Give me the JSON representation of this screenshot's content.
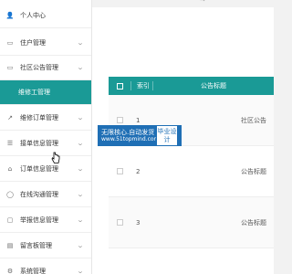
{
  "breadcrumb": "→",
  "sidebar": {
    "items": [
      {
        "label": "个人中心",
        "icon": "user-icon",
        "glyph": "👤",
        "active": false
      },
      {
        "label": "住户管理",
        "icon": "list-icon",
        "glyph": "▭",
        "active": false
      },
      {
        "label": "社区公告管理",
        "icon": "list-icon",
        "glyph": "▭",
        "active": false
      },
      {
        "label": "维修工管理",
        "icon": "",
        "glyph": "",
        "active": true
      },
      {
        "label": "维修订单管理",
        "icon": "chart-icon",
        "glyph": "↗",
        "active": false
      },
      {
        "label": "接单信息管理",
        "icon": "menu-icon",
        "glyph": "☰",
        "active": false
      },
      {
        "label": "订单信息管理",
        "icon": "cart-icon",
        "glyph": "⌂",
        "active": false
      },
      {
        "label": "在线沟通管理",
        "icon": "chat-icon",
        "glyph": "◯",
        "active": false
      },
      {
        "label": "举报信息管理",
        "icon": "copy-icon",
        "glyph": "▢",
        "active": false
      },
      {
        "label": "留言板管理",
        "icon": "message-icon",
        "glyph": "▤",
        "active": false
      },
      {
        "label": "系统管理",
        "icon": "gear-icon",
        "glyph": "⚙",
        "active": false
      }
    ]
  },
  "table": {
    "headers": {
      "index": "索引",
      "title": "公告标题"
    },
    "rows": [
      {
        "index": "1",
        "title": "社区公告"
      },
      {
        "index": "2",
        "title": "公告标题"
      },
      {
        "index": "3",
        "title": "公告标题"
      }
    ]
  },
  "watermark": {
    "line1": "无限核心.自动发货",
    "line2": "www.51topmind.com",
    "side": "毕业设计"
  },
  "colors": {
    "accent": "#1a9a96",
    "watermark": "#1f6fb5"
  }
}
